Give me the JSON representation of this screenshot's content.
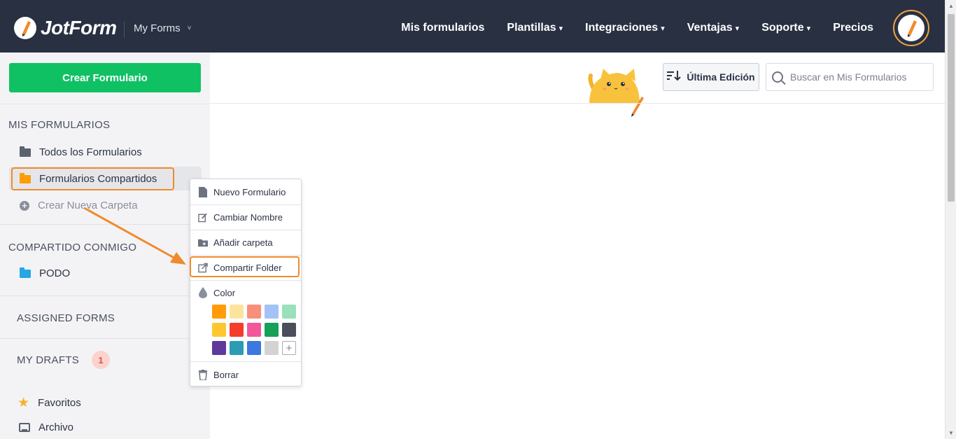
{
  "app": {
    "logo_text": "JotForm",
    "myforms_dropdown": "My Forms"
  },
  "nav": {
    "items": [
      {
        "label": "Mis formularios",
        "dropdown": false
      },
      {
        "label": "Plantillas",
        "dropdown": true
      },
      {
        "label": "Integraciones",
        "dropdown": true
      },
      {
        "label": "Ventajas",
        "dropdown": true
      },
      {
        "label": "Soporte",
        "dropdown": true
      },
      {
        "label": "Precios",
        "dropdown": false
      }
    ],
    "caret": "▾"
  },
  "sidebar": {
    "create_button": "Crear Formulario",
    "my_forms_title": "MIS FORMULARIOS",
    "all_forms": "Todos los Formularios",
    "shared_forms": "Formularios Compartidos",
    "new_folder": "Crear Nueva Carpeta",
    "shared_with_me_title": "COMPARTIDO CONMIGO",
    "podo_folder": "PODO",
    "assigned_title": "ASSIGNED FORMS",
    "drafts_title": "MY DRAFTS",
    "drafts_count": "1",
    "favorites": "Favoritos",
    "archive": "Archivo"
  },
  "toolbar": {
    "sort_label": "Última Edición",
    "search_placeholder": "Buscar en Mis Formularios"
  },
  "context_menu": {
    "new_form": "Nuevo Formulario",
    "rename": "Cambiar Nombre",
    "add_folder": "Añadir carpeta",
    "share_folder": "Compartir Folder",
    "color": "Color",
    "delete": "Borrar",
    "swatches": [
      "#ff9c07",
      "#fde49e",
      "#f88f7a",
      "#a3c3f7",
      "#99e0bb",
      "#fec732",
      "#f63d2c",
      "#f25899",
      "#14a158",
      "#4c4e5b",
      "#60399d",
      "#2b9cb3",
      "#3c78e0",
      "#d3d3d3"
    ]
  },
  "colors": {
    "topbar": "#283042",
    "accent_green": "#10c164",
    "highlight_orange": "#f08a2c",
    "folder_orange": "#ff9c07",
    "folder_gray": "#5c6170",
    "folder_blue": "#28a7e5"
  }
}
